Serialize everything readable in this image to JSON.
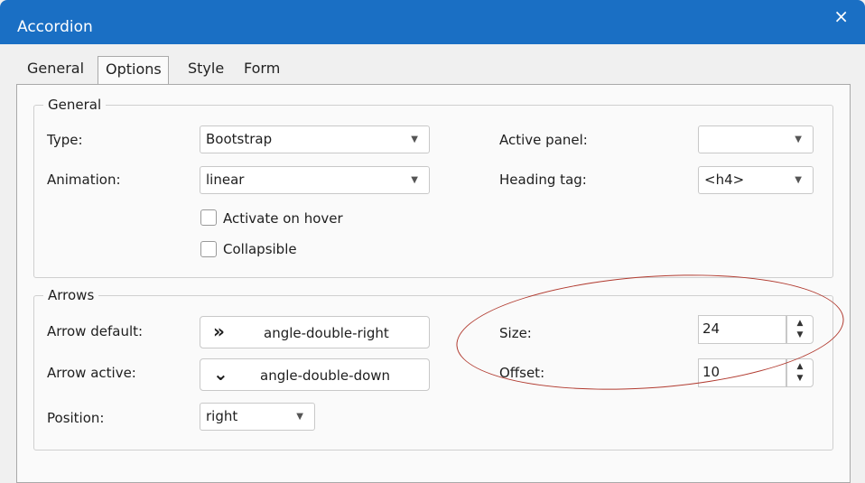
{
  "window": {
    "title": "Accordion"
  },
  "tabs": [
    "General",
    "Options",
    "Style",
    "Form"
  ],
  "general": {
    "legend": "General",
    "type_label": "Type:",
    "type_value": "Bootstrap",
    "animation_label": "Animation:",
    "animation_value": "linear",
    "active_panel_label": "Active panel:",
    "active_panel_value": "",
    "heading_tag_label": "Heading tag:",
    "heading_tag_value": "<h4>",
    "activate_on_hover": "Activate on hover",
    "collapsible": "Collapsible"
  },
  "arrows": {
    "legend": "Arrows",
    "default_label": "Arrow default:",
    "default_value": "angle-double-right",
    "active_label": "Arrow active:",
    "active_value": "angle-double-down",
    "position_label": "Position:",
    "position_value": "right",
    "size_label": "Size:",
    "size_value": "24",
    "offset_label": "Offset:",
    "offset_value": "10"
  },
  "icons": {
    "close": "×",
    "default_arrow": "»",
    "active_arrow": "⌄"
  }
}
